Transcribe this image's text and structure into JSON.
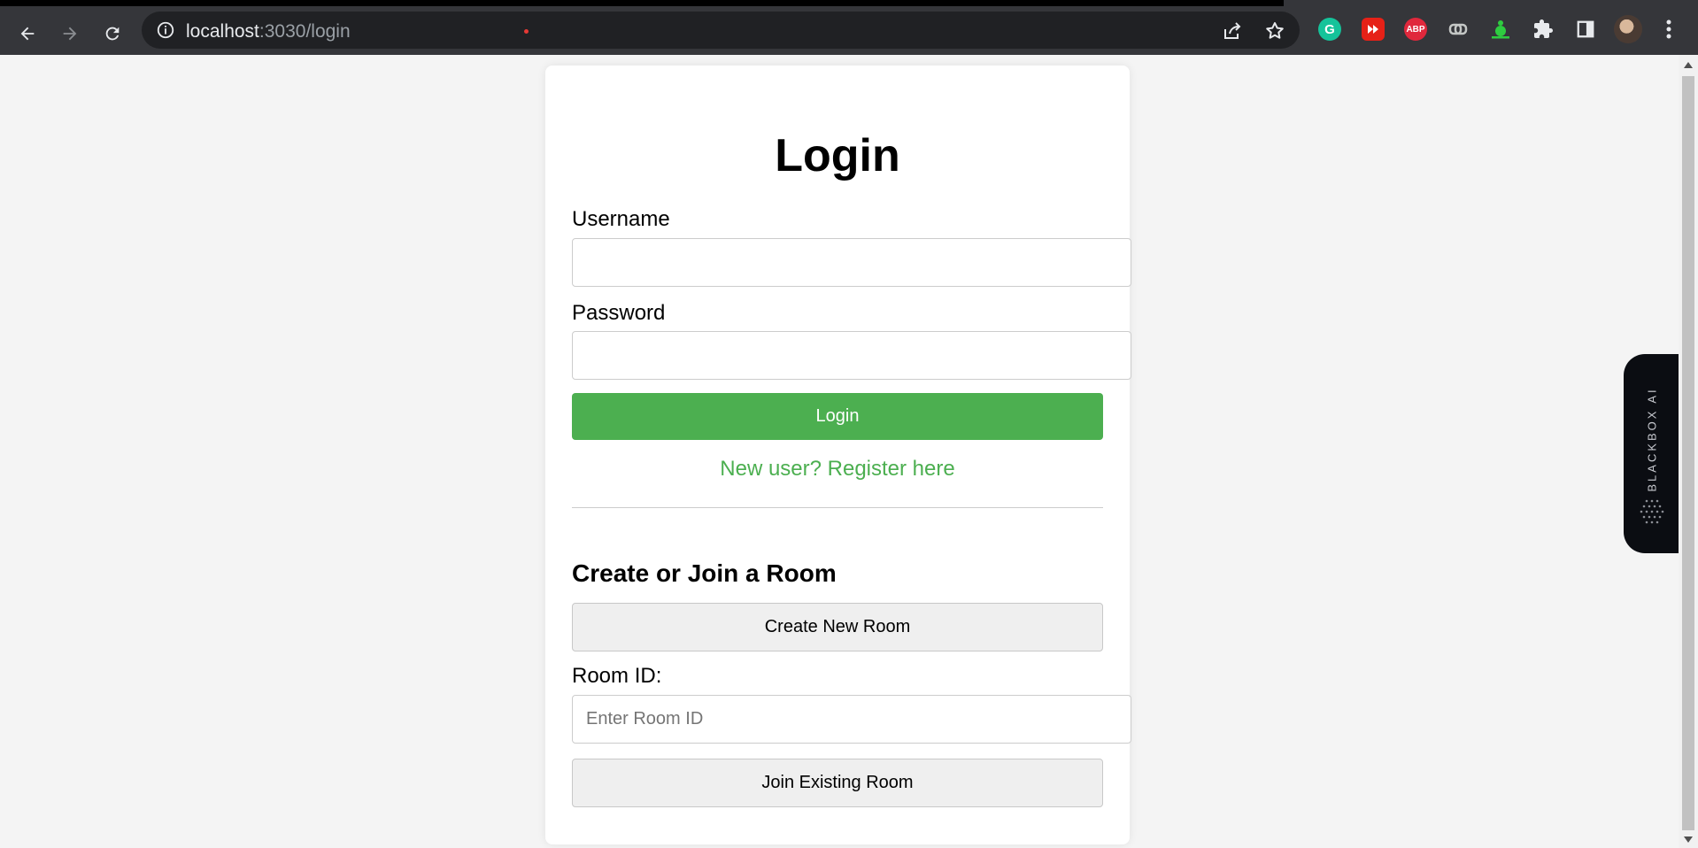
{
  "browser": {
    "url_host": "localhost",
    "url_path": ":3030/login",
    "icons": {
      "back": "arrow-left-icon",
      "forward": "arrow-right-icon",
      "reload": "reload-icon",
      "site_info": "info-icon",
      "share": "share-icon",
      "bookmark": "star-icon",
      "grammarly": "G",
      "abp": "ABP"
    }
  },
  "login": {
    "title": "Login",
    "username_label": "Username",
    "username_value": "",
    "password_label": "Password",
    "password_value": "",
    "login_button": "Login",
    "register_link": "New user? Register here"
  },
  "room": {
    "heading": "Create or Join a Room",
    "create_button": "Create New Room",
    "room_id_label": "Room ID:",
    "room_id_placeholder": "Enter Room ID",
    "room_id_value": "",
    "join_button": "Join Existing Room"
  },
  "blackbox_widget": {
    "label": "BLACKBOX AI"
  },
  "colors": {
    "accent_green": "#4caf50",
    "page_background": "#f4f4f4",
    "browser_toolbar": "#35363a"
  }
}
